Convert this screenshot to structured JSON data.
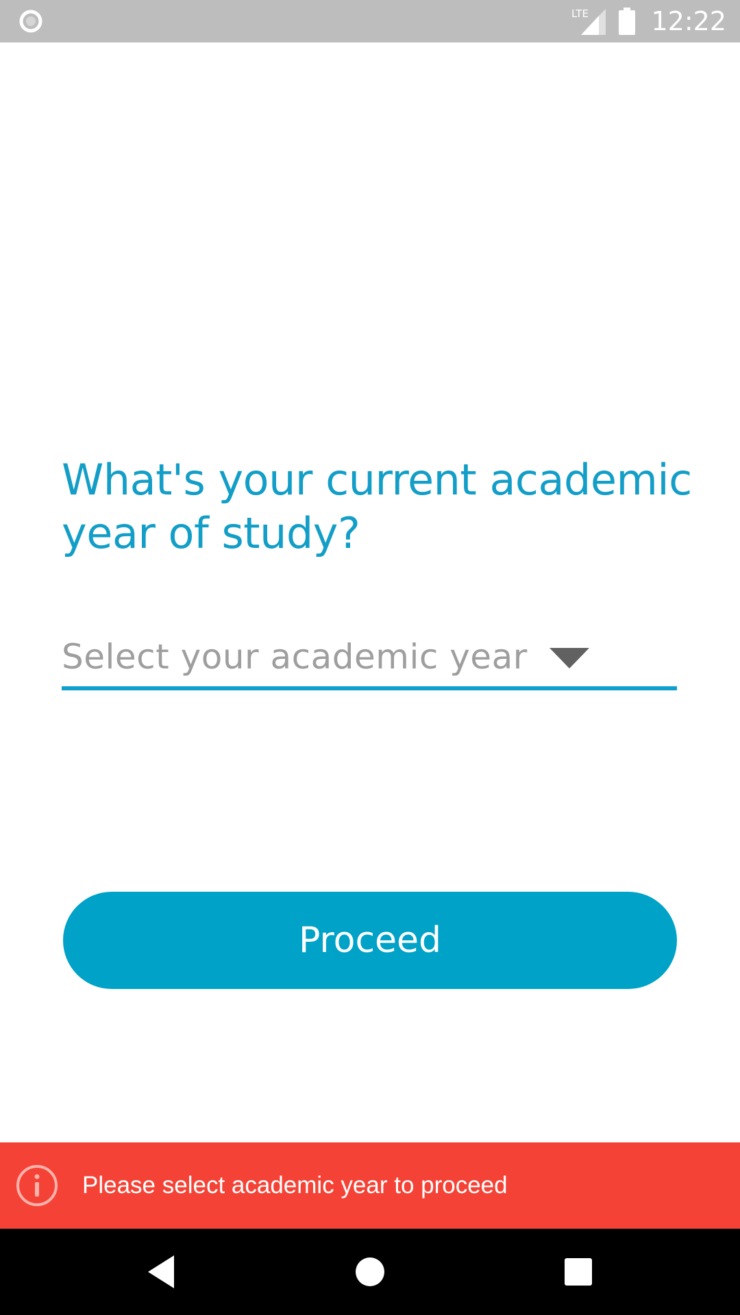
{
  "status_bar": {
    "time": "12:22",
    "network_label": "LTE",
    "left_icon": "record-indicator-icon",
    "signal_icon": "signal-icon",
    "battery_icon": "battery-icon"
  },
  "question": {
    "text": "What's your current academic year of study?"
  },
  "academic_year_select": {
    "placeholder": "Select your academic year",
    "selected_value": "",
    "icon": "dropdown-arrow-icon"
  },
  "proceed_button": {
    "label": "Proceed"
  },
  "snackbar": {
    "icon": "info-icon",
    "message": "Please select academic year to proceed"
  },
  "nav_bar": {
    "back_icon": "back-icon",
    "home_icon": "home-icon",
    "recents_icon": "recents-icon"
  },
  "colors": {
    "accent": "#00a2c8",
    "question_text": "#139ec8",
    "error": "#f44336",
    "status_bar": "#bdbdbd",
    "placeholder": "#9e9e9e"
  }
}
